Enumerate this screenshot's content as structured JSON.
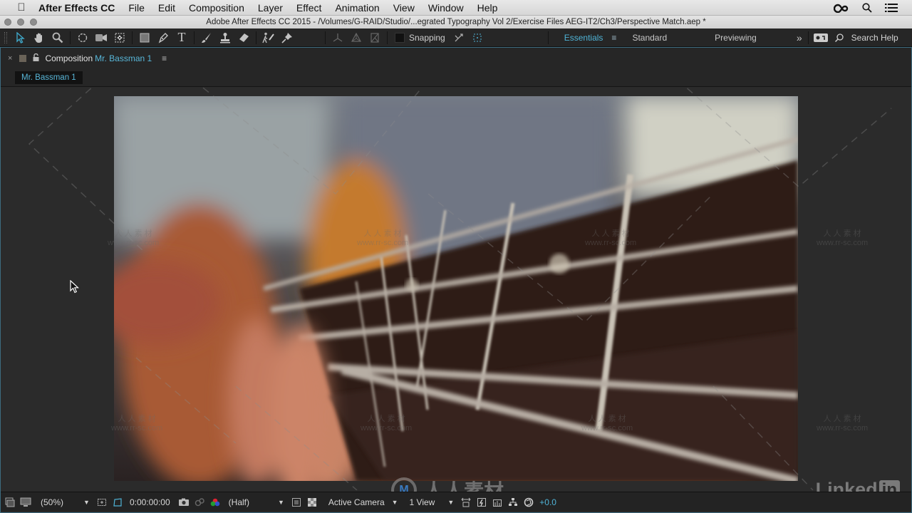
{
  "menubar": {
    "app_name": "After Effects CC",
    "items": [
      "File",
      "Edit",
      "Composition",
      "Layer",
      "Effect",
      "Animation",
      "View",
      "Window",
      "Help"
    ],
    "right_icons": [
      "creative-cloud-icon",
      "spotlight-search-icon",
      "notification-list-icon"
    ]
  },
  "window": {
    "title": "Adobe After Effects CC 2015 - /Volumes/G-RAID/Studio/...egrated Typography Vol 2/Exercise Files AEG-IT2/Ch3/Perspective Match.aep *"
  },
  "toolbar": {
    "tools": [
      {
        "name": "selection-tool",
        "glyph": "➤",
        "active": true
      },
      {
        "name": "hand-tool",
        "glyph": "✋"
      },
      {
        "name": "zoom-tool",
        "glyph": "🔍"
      },
      {
        "name": "rotation-tool",
        "glyph": "↻"
      },
      {
        "name": "camera-tool",
        "glyph": "■◀"
      },
      {
        "name": "pan-behind-tool",
        "glyph": "⛶"
      },
      {
        "name": "rectangle-tool",
        "glyph": "▭"
      },
      {
        "name": "pen-tool",
        "glyph": "✒"
      },
      {
        "name": "type-tool",
        "glyph": "T"
      },
      {
        "name": "brush-tool",
        "glyph": "/"
      },
      {
        "name": "clone-stamp-tool",
        "glyph": "⊥"
      },
      {
        "name": "eraser-tool",
        "glyph": "◆"
      },
      {
        "name": "roto-brush-tool",
        "glyph": "✍"
      },
      {
        "name": "puppet-pin-tool",
        "glyph": "📌"
      }
    ],
    "axis_tools": [
      "local-axis-mode",
      "world-axis-mode",
      "view-axis-mode"
    ],
    "snapping_label": "Snapping",
    "workspaces": {
      "essentials": "Essentials",
      "standard": "Standard",
      "previewing": "Previewing",
      "more": "»"
    },
    "search_help": "Search Help"
  },
  "panel": {
    "tab_prefix": "Composition",
    "comp_name": "Mr. Bassman 1",
    "breadcrumb": "Mr. Bassman 1",
    "menu_glyph": "≡",
    "close_glyph": "×"
  },
  "viewer_footer": {
    "magnification": "(50%)",
    "timecode": "0:00:00:00",
    "resolution": "(Half)",
    "view": "Active Camera",
    "layout": "1 View",
    "exposure": "+0.0"
  },
  "watermark": {
    "chinese": "人 人 素 材",
    "url": "www.rr-sc.com",
    "logo_text": "人人素材"
  },
  "branding": {
    "linkedin_text": "Linked",
    "linkedin_box": "in"
  },
  "colors": {
    "accent": "#4fb3d6",
    "panel_border": "#3d6c80",
    "panel_bg": "#2b2b2b"
  }
}
